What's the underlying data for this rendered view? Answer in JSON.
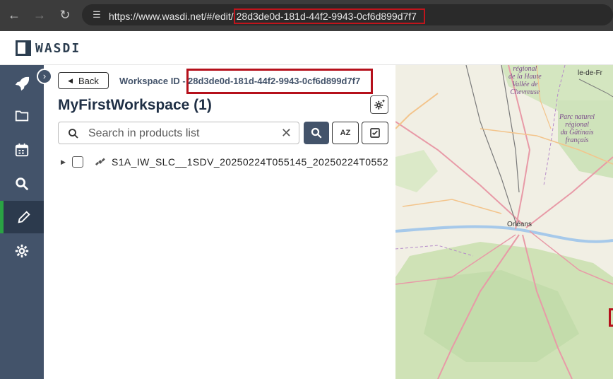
{
  "browser": {
    "url_prefix": "https://www.wasdi.net/#/edit/",
    "url_id": "28d3de0d-181d-44f2-9943-0cf6d899d7f7",
    "icons": [
      "arrow-left-icon",
      "arrow-right-icon",
      "reload-icon",
      "site-settings-icon"
    ]
  },
  "app": {
    "logo_text": "WASDI"
  },
  "sidebar": {
    "items": [
      {
        "name": "launch",
        "icon": "rocket-icon"
      },
      {
        "name": "workspaces",
        "icon": "folder-icon"
      },
      {
        "name": "plan",
        "icon": "calendar-icon"
      },
      {
        "name": "search",
        "icon": "search-icon"
      },
      {
        "name": "edit",
        "icon": "pencil-icon",
        "active": true
      },
      {
        "name": "settings",
        "icon": "gear-icon"
      }
    ],
    "accent": "#2aa344",
    "bg": "#43536a"
  },
  "workspace": {
    "back_label": "Back",
    "id_label": "Workspace ID - ",
    "id_value": "28d3de0d-181d-44f2-9943-0cf6d899d7f7",
    "title": "MyFirstWorkspace (1)"
  },
  "search": {
    "placeholder": "Search in products list",
    "value": "",
    "clear_icon": "close-icon"
  },
  "sort_label": "AZ",
  "products": [
    {
      "name": "S1A_IW_SLC__1SDV_20250224T055145_20250224T0552",
      "icon": "satellite-icon",
      "checked": false
    }
  ],
  "map": {
    "labels": {
      "region1": "régional\nde la Haute\nVallée de\nChevreuse",
      "region2": "Parc naturel\nrégional\ndu Gâtinais\nfrançais",
      "city1": "Orléans",
      "city2": "le-de-Fr"
    }
  },
  "highlight_color": "#c0151c"
}
